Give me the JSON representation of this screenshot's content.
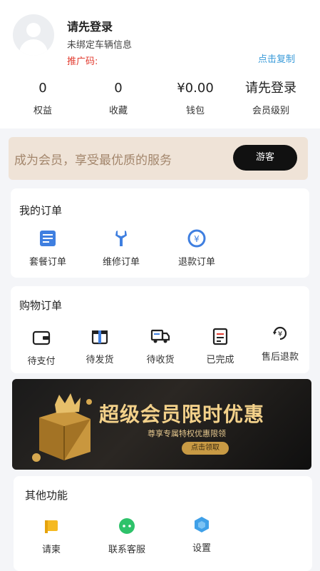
{
  "profile": {
    "name": "请先登录",
    "vehicle": "未绑定车辆信息",
    "promo_label": "推广码:",
    "copy_link": "点击复制"
  },
  "stats": [
    {
      "value": "0",
      "label": "权益"
    },
    {
      "value": "0",
      "label": "收藏"
    },
    {
      "value": "¥0.00",
      "label": "钱包"
    },
    {
      "value": "请先登录",
      "label": "会员级别"
    }
  ],
  "membership": {
    "text": "成为会员，享受最优质的服务",
    "button": "游客"
  },
  "my_orders": {
    "title": "我的订单",
    "items": [
      {
        "label": "套餐订单",
        "icon": "package-order-icon"
      },
      {
        "label": "维修订单",
        "icon": "wrench-icon"
      },
      {
        "label": "退款订单",
        "icon": "refund-icon"
      }
    ]
  },
  "shopping_orders": {
    "title": "购物订单",
    "items": [
      {
        "label": "待支付",
        "icon": "wallet-icon"
      },
      {
        "label": "待发货",
        "icon": "gift-box-icon"
      },
      {
        "label": "待收货",
        "icon": "truck-icon"
      },
      {
        "label": "已完成",
        "icon": "checklist-icon"
      },
      {
        "label": "售后退款",
        "icon": "yuan-refund-icon"
      }
    ]
  },
  "banner": {
    "title": "超级会员限时优惠",
    "subtitle": "尊享专属特权优惠限领",
    "cta": "点击领取"
  },
  "other": {
    "title": "其他功能",
    "items": [
      {
        "label": "请柬",
        "icon": "flag-icon"
      },
      {
        "label": "联系客服",
        "icon": "chat-icon"
      },
      {
        "label": "设置",
        "icon": "settings-icon"
      }
    ]
  },
  "colors": {
    "accent_blue": "#3a9bd9",
    "promo_red": "#e23b2f",
    "member_bg": "#efe3d7",
    "gold": "#f3d18a"
  }
}
